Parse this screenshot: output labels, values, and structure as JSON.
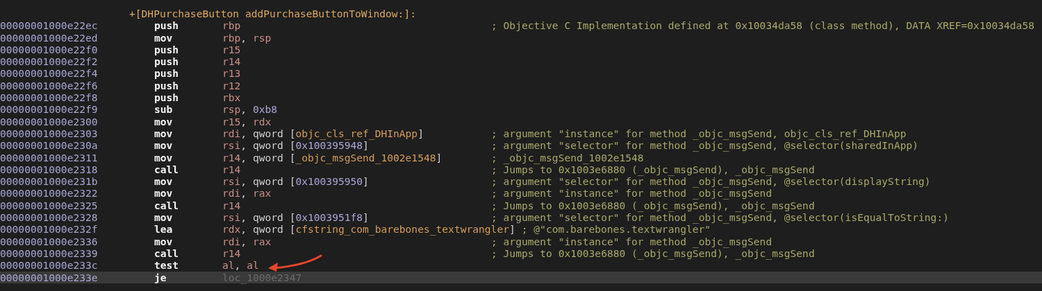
{
  "procedure": {
    "header": "+[DHPurchaseButton addPurchaseButtonToWindow:]:"
  },
  "rows": [
    {
      "address": "00000001000e22ec",
      "mnemonic": "push",
      "operands": [
        {
          "kind": "reg",
          "text": "rbp"
        }
      ],
      "comment": "; Objective C Implementation defined at 0x10034da58 (class method), DATA XREF=0x10034da58",
      "selected": false
    },
    {
      "address": "00000001000e22ed",
      "mnemonic": "mov",
      "operands": [
        {
          "kind": "reg",
          "text": "rbp"
        },
        {
          "kind": "plain",
          "text": ", "
        },
        {
          "kind": "reg",
          "text": "rsp"
        }
      ],
      "selected": false
    },
    {
      "address": "00000001000e22f0",
      "mnemonic": "push",
      "operands": [
        {
          "kind": "reg",
          "text": "r15"
        }
      ],
      "selected": false
    },
    {
      "address": "00000001000e22f2",
      "mnemonic": "push",
      "operands": [
        {
          "kind": "reg",
          "text": "r14"
        }
      ],
      "selected": false
    },
    {
      "address": "00000001000e22f4",
      "mnemonic": "push",
      "operands": [
        {
          "kind": "reg",
          "text": "r13"
        }
      ],
      "selected": false
    },
    {
      "address": "00000001000e22f6",
      "mnemonic": "push",
      "operands": [
        {
          "kind": "reg",
          "text": "r12"
        }
      ],
      "selected": false
    },
    {
      "address": "00000001000e22f8",
      "mnemonic": "push",
      "operands": [
        {
          "kind": "reg",
          "text": "rbx"
        }
      ],
      "selected": false
    },
    {
      "address": "00000001000e22f9",
      "mnemonic": "sub",
      "operands": [
        {
          "kind": "reg",
          "text": "rsp"
        },
        {
          "kind": "plain",
          "text": ", "
        },
        {
          "kind": "num",
          "text": "0xb8"
        }
      ],
      "selected": false
    },
    {
      "address": "00000001000e2300",
      "mnemonic": "mov",
      "operands": [
        {
          "kind": "reg",
          "text": "r15"
        },
        {
          "kind": "plain",
          "text": ", "
        },
        {
          "kind": "reg",
          "text": "rdx"
        }
      ],
      "selected": false
    },
    {
      "address": "00000001000e2303",
      "mnemonic": "mov",
      "operands": [
        {
          "kind": "reg",
          "text": "rdi"
        },
        {
          "kind": "plain",
          "text": ", qword ["
        },
        {
          "kind": "sym",
          "text": "objc_cls_ref_DHInApp"
        },
        {
          "kind": "plain",
          "text": "]"
        }
      ],
      "comment": "; argument \"instance\" for method _objc_msgSend, objc_cls_ref_DHInApp",
      "selected": false
    },
    {
      "address": "00000001000e230a",
      "mnemonic": "mov",
      "operands": [
        {
          "kind": "reg",
          "text": "rsi"
        },
        {
          "kind": "plain",
          "text": ", qword ["
        },
        {
          "kind": "num",
          "text": "0x100395948"
        },
        {
          "kind": "plain",
          "text": "]"
        }
      ],
      "comment": "; argument \"selector\" for method _objc_msgSend, @selector(sharedInApp)",
      "selected": false
    },
    {
      "address": "00000001000e2311",
      "mnemonic": "mov",
      "operands": [
        {
          "kind": "reg",
          "text": "r14"
        },
        {
          "kind": "plain",
          "text": ", qword ["
        },
        {
          "kind": "sym",
          "text": "_objc_msgSend_1002e1548"
        },
        {
          "kind": "plain",
          "text": "]"
        }
      ],
      "comment": "; _objc_msgSend_1002e1548",
      "selected": false
    },
    {
      "address": "00000001000e2318",
      "mnemonic": "call",
      "operands": [
        {
          "kind": "reg",
          "text": "r14"
        }
      ],
      "comment": "; Jumps to 0x1003e6880 (_objc_msgSend), _objc_msgSend",
      "selected": false
    },
    {
      "address": "00000001000e231b",
      "mnemonic": "mov",
      "operands": [
        {
          "kind": "reg",
          "text": "rsi"
        },
        {
          "kind": "plain",
          "text": ", qword ["
        },
        {
          "kind": "num",
          "text": "0x100395950"
        },
        {
          "kind": "plain",
          "text": "]"
        }
      ],
      "comment": "; argument \"selector\" for method _objc_msgSend, @selector(displayString)",
      "selected": false
    },
    {
      "address": "00000001000e2322",
      "mnemonic": "mov",
      "operands": [
        {
          "kind": "reg",
          "text": "rdi"
        },
        {
          "kind": "plain",
          "text": ", "
        },
        {
          "kind": "reg",
          "text": "rax"
        }
      ],
      "comment": "; argument \"instance\" for method _objc_msgSend",
      "selected": false
    },
    {
      "address": "00000001000e2325",
      "mnemonic": "call",
      "operands": [
        {
          "kind": "reg",
          "text": "r14"
        }
      ],
      "comment": "; Jumps to 0x1003e6880 (_objc_msgSend), _objc_msgSend",
      "selected": false
    },
    {
      "address": "00000001000e2328",
      "mnemonic": "mov",
      "operands": [
        {
          "kind": "reg",
          "text": "rsi"
        },
        {
          "kind": "plain",
          "text": ", qword ["
        },
        {
          "kind": "num",
          "text": "0x1003951f8"
        },
        {
          "kind": "plain",
          "text": "]"
        }
      ],
      "comment": "; argument \"selector\" for method _objc_msgSend, @selector(isEqualToString:)",
      "selected": false
    },
    {
      "address": "00000001000e232f",
      "mnemonic": "lea",
      "operands": [
        {
          "kind": "reg",
          "text": "rdx"
        },
        {
          "kind": "plain",
          "text": ", qword ["
        },
        {
          "kind": "sym",
          "text": "cfstring_com_barebones_textwrangler"
        },
        {
          "kind": "plain",
          "text": "]"
        }
      ],
      "comment": "; @\"com.barebones.textwrangler\"",
      "selected": false
    },
    {
      "address": "00000001000e2336",
      "mnemonic": "mov",
      "operands": [
        {
          "kind": "reg",
          "text": "rdi"
        },
        {
          "kind": "plain",
          "text": ", "
        },
        {
          "kind": "reg",
          "text": "rax"
        }
      ],
      "comment": "; argument \"instance\" for method _objc_msgSend",
      "selected": false
    },
    {
      "address": "00000001000e2339",
      "mnemonic": "call",
      "operands": [
        {
          "kind": "reg",
          "text": "r14"
        }
      ],
      "comment": "; Jumps to 0x1003e6880 (_objc_msgSend), _objc_msgSend",
      "selected": false
    },
    {
      "address": "00000001000e233c",
      "mnemonic": "test",
      "operands": [
        {
          "kind": "reg",
          "text": "al"
        },
        {
          "kind": "plain",
          "text": ", "
        },
        {
          "kind": "reg",
          "text": "al"
        }
      ],
      "selected": false
    },
    {
      "address": "00000001000e233e",
      "mnemonic": "je",
      "operands": [
        {
          "kind": "label",
          "text": "loc_1000e2347"
        }
      ],
      "selected": true
    }
  ]
}
